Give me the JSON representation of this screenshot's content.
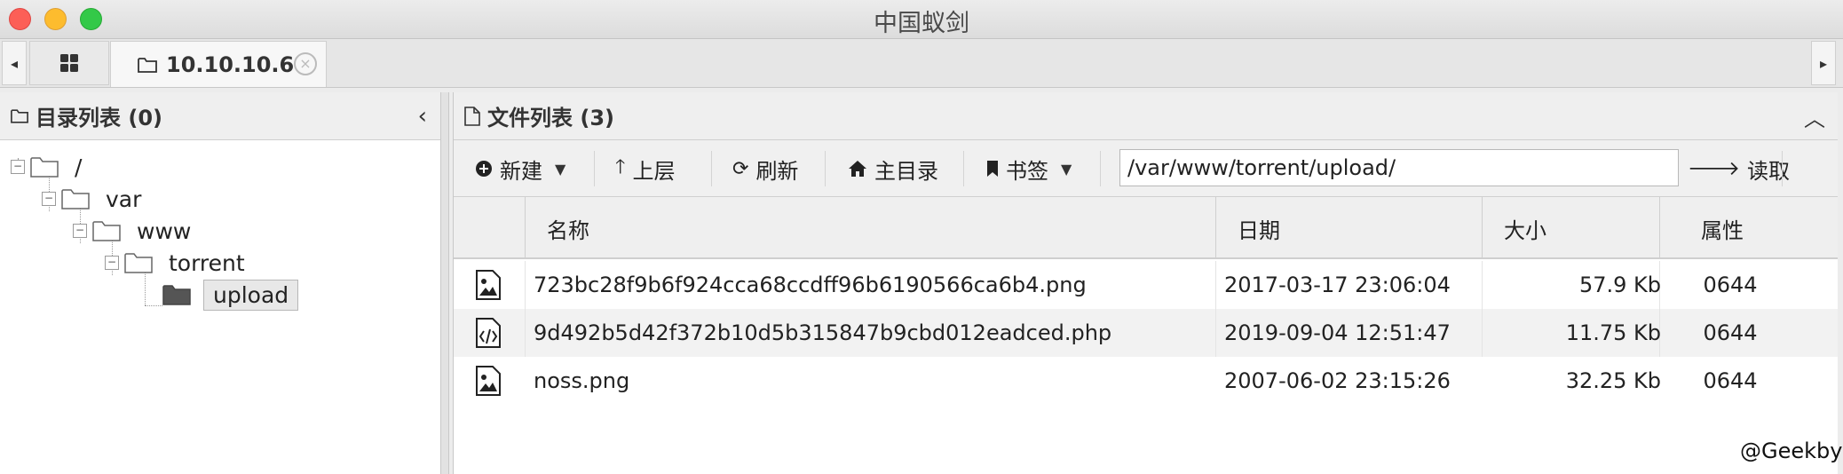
{
  "window": {
    "title": "中国蚁剑"
  },
  "tabs": {
    "left_arrow": "◂",
    "right_arrow": "▸",
    "active_label": "10.10.10.6",
    "close_glyph": "×"
  },
  "left_panel": {
    "title": "目录列表 (0)",
    "collapse_glyph": "‹",
    "tree": [
      {
        "label": "/",
        "depth": 0
      },
      {
        "label": "var",
        "depth": 1
      },
      {
        "label": "www",
        "depth": 2
      },
      {
        "label": "torrent",
        "depth": 3
      },
      {
        "label": "upload",
        "depth": 4,
        "selected": true
      }
    ],
    "toggle_glyph": "−"
  },
  "right_panel": {
    "title": "文件列表 (3)",
    "collapse_glyph": "︿",
    "toolbar": {
      "new_label": "新建",
      "up_label": "上层",
      "refresh_label": "刷新",
      "home_label": "主目录",
      "bookmark_label": "书签",
      "path_value": "/var/www/torrent/upload/",
      "read_label": "读取"
    },
    "columns": {
      "name": "名称",
      "date": "日期",
      "size": "大小",
      "perm": "属性"
    },
    "files": [
      {
        "name": "723bc28f9b6f924cca68ccdff96b6190566ca6b4.png",
        "date": "2017-03-17 23:06:04",
        "size": "57.9 Kb",
        "perm": "0644",
        "icon": "image-file-icon"
      },
      {
        "name": "9d492b5d42f372b10d5b315847b9cbd012eadced.php",
        "date": "2019-09-04 12:51:47",
        "size": "11.75 Kb",
        "perm": "0644",
        "icon": "code-file-icon"
      },
      {
        "name": "noss.png",
        "date": "2007-06-02 23:15:26",
        "size": "32.25 Kb",
        "perm": "0644",
        "icon": "image-file-icon"
      }
    ]
  },
  "watermark": "@Geekby",
  "colors": {
    "close": "#fc5f57",
    "minimize": "#fdbc2e",
    "maximize": "#33c948"
  }
}
